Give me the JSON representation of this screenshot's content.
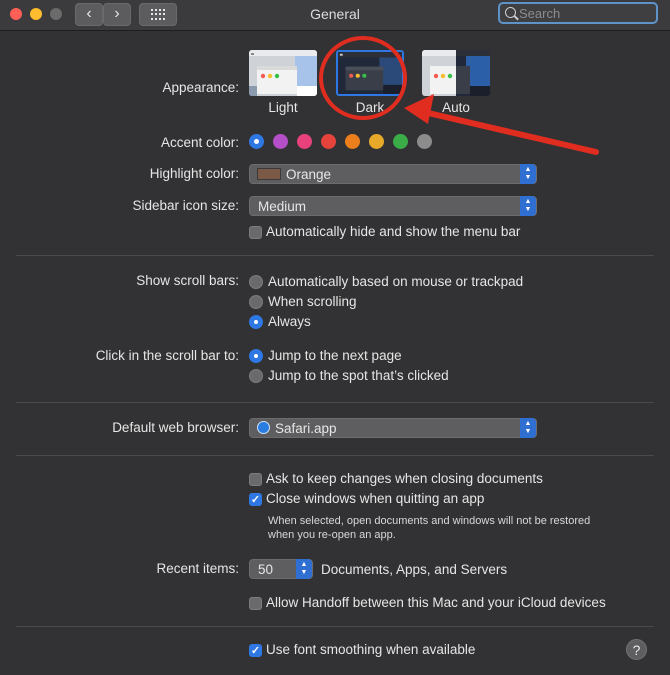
{
  "window": {
    "title": "General",
    "search": {
      "placeholder": "Search",
      "value": ""
    }
  },
  "appearance": {
    "label": "Appearance:",
    "options": [
      {
        "name": "Light",
        "selected": false
      },
      {
        "name": "Dark",
        "selected": true
      },
      {
        "name": "Auto",
        "selected": false
      }
    ]
  },
  "accent": {
    "label": "Accent color:",
    "colors": [
      "#2f78e4",
      "#b44fc7",
      "#e8417c",
      "#e5433b",
      "#ec7f1c",
      "#e6a92a",
      "#3aad49",
      "#8c8c8c"
    ],
    "selected_index": 0
  },
  "highlight": {
    "label": "Highlight color:",
    "value": "Orange",
    "swatch": "#7a5a46"
  },
  "sidebar_icon": {
    "label": "Sidebar icon size:",
    "value": "Medium"
  },
  "menu_bar": {
    "label": "Automatically hide and show the menu bar",
    "checked": false
  },
  "scroll_bars": {
    "label": "Show scroll bars:",
    "options": [
      {
        "label": "Automatically based on mouse or trackpad",
        "selected": false
      },
      {
        "label": "When scrolling",
        "selected": false
      },
      {
        "label": "Always",
        "selected": true
      }
    ]
  },
  "click_scroll": {
    "label": "Click in the scroll bar to:",
    "options": [
      {
        "label": "Jump to the next page",
        "selected": true
      },
      {
        "label": "Jump to the spot that’s clicked",
        "selected": false
      }
    ]
  },
  "browser": {
    "label": "Default web browser:",
    "value": "Safari.app"
  },
  "documents": {
    "ask_keep": {
      "label": "Ask to keep changes when closing documents",
      "checked": false
    },
    "close_windows": {
      "label": "Close windows when quitting an app",
      "checked": true
    },
    "note_line1": "When selected, open documents and windows will not be restored",
    "note_line2": "when you re-open an app."
  },
  "recent": {
    "label": "Recent items:",
    "value": "50",
    "suffix": "Documents, Apps, and Servers"
  },
  "handoff": {
    "label": "Allow Handoff between this Mac and your iCloud devices",
    "checked": false
  },
  "font_smoothing": {
    "label": "Use font smoothing when available",
    "checked": true
  },
  "help": {
    "glyph": "?"
  },
  "annotation": {
    "color": "#e02d1f"
  }
}
